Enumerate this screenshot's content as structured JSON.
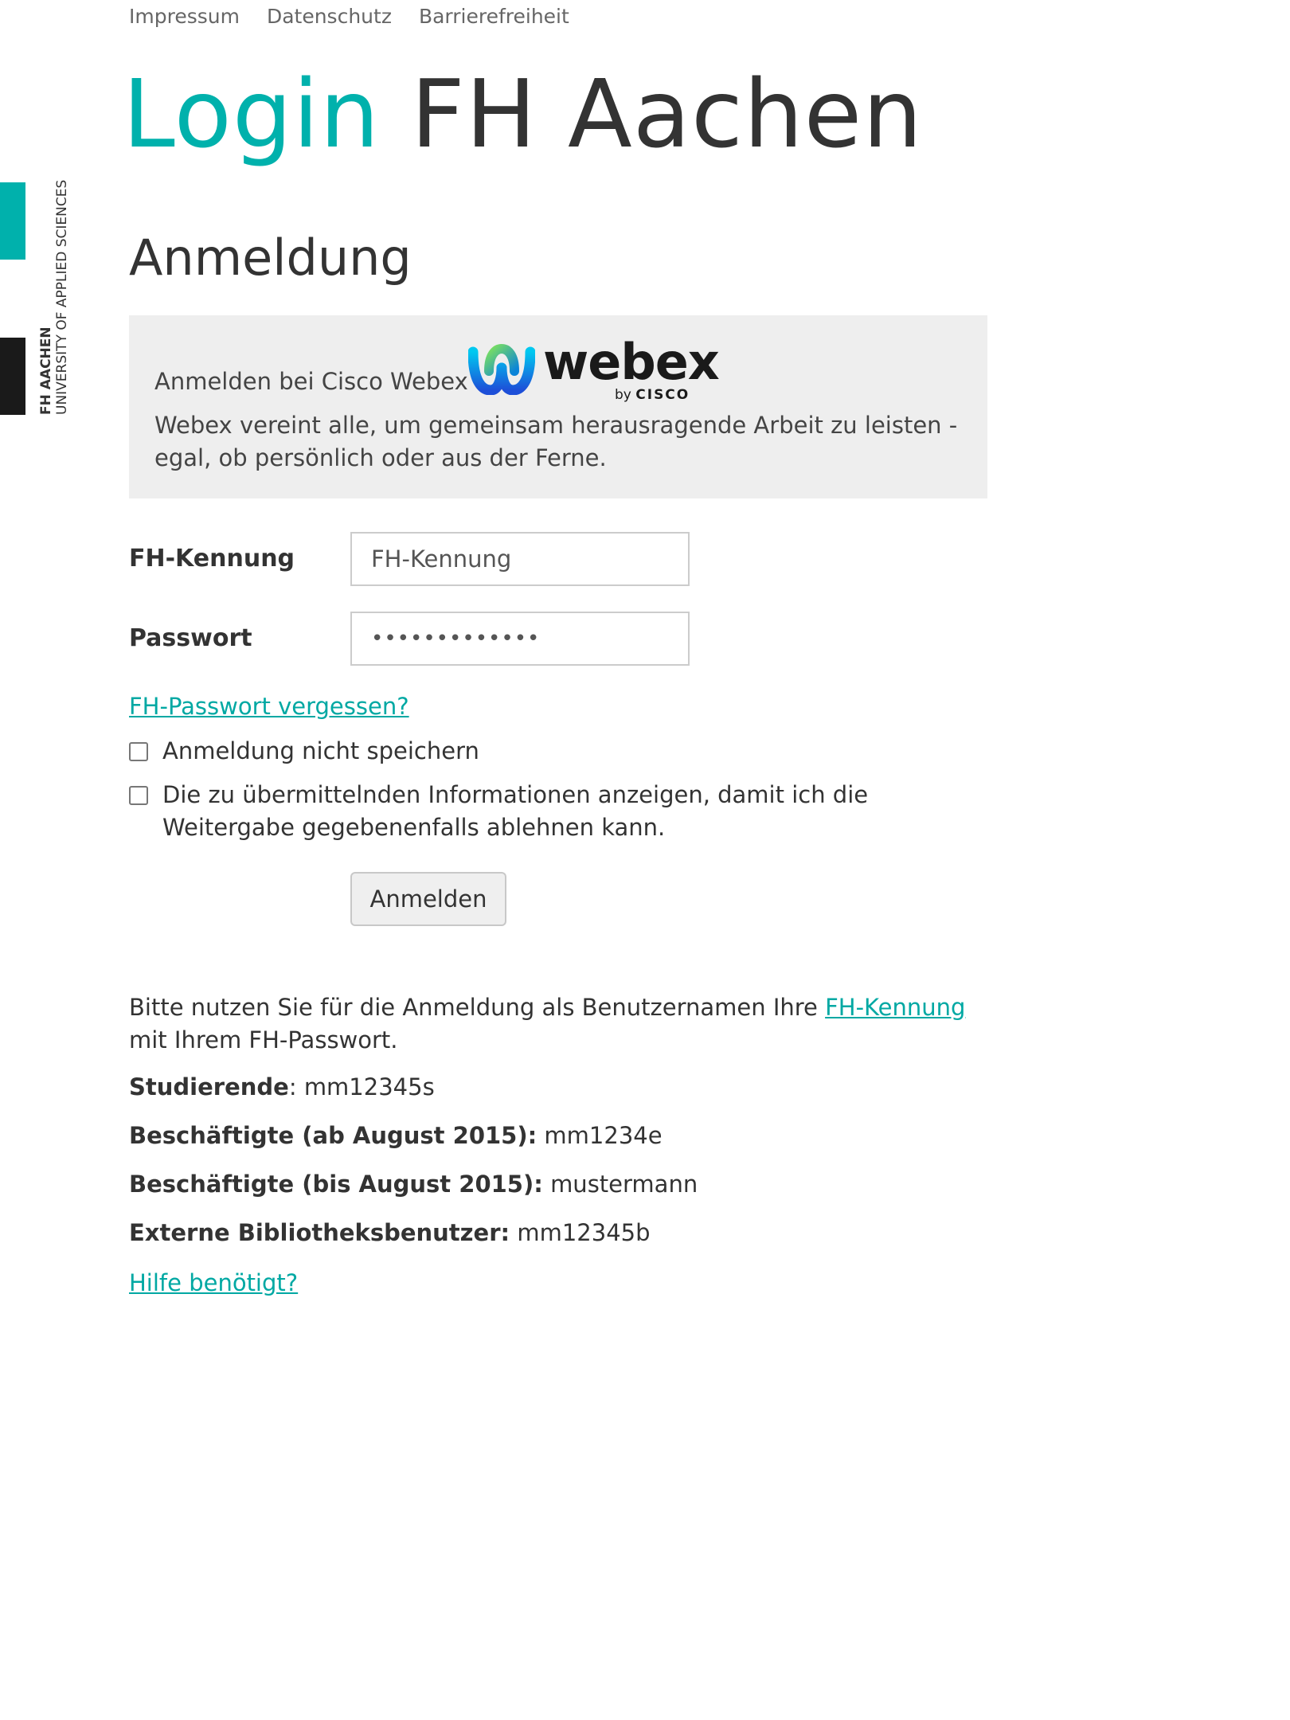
{
  "topnav": {
    "items": [
      "Impressum",
      "Datenschutz",
      "Barrierefreiheit"
    ]
  },
  "hero": {
    "accent": "Login",
    "rest": "FH Aachen"
  },
  "brand": {
    "line1": "FH AACHEN",
    "line2": "UNIVERSITY OF APPLIED SCIENCES"
  },
  "section_title": "Anmeldung",
  "service": {
    "label": "Anmelden bei Cisco Webex",
    "logo_word": "webex",
    "logo_by": "by",
    "logo_cisco": "CISCO",
    "description": "Webex vereint alle, um gemeinsam herausragende Arbeit zu leisten - egal, ob persönlich oder aus der Ferne."
  },
  "form": {
    "username_label": "FH-Kennung",
    "username_placeholder": "FH-Kennung",
    "username_value": "",
    "password_label": "Passwort",
    "password_value": "•••••••••••••",
    "forgot_link": "FH-Passwort vergessen?",
    "checkbox_dont_save": "Anmeldung nicht speichern",
    "checkbox_show_info": "Die zu übermittelnden Informationen anzeigen, damit ich die Weitergabe gegebenenfalls ablehnen kann.",
    "submit_label": "Anmelden"
  },
  "help": {
    "intro_before": "Bitte nutzen Sie für die Anmeldung als Benutzernamen Ihre",
    "intro_link": "FH-Kennung",
    "intro_after": "mit Ihrem FH-Passwort.",
    "examples": [
      {
        "label": "Studierende",
        "sep": ":",
        "value": "mm12345s"
      },
      {
        "label": "Beschäftigte (ab August 2015):",
        "sep": "",
        "value": "mm1234e"
      },
      {
        "label": "Beschäftigte (bis August 2015):",
        "sep": "",
        "value": "mustermann"
      },
      {
        "label": "Externe Bibliotheksbenutzer:",
        "sep": "",
        "value": "mm12345b"
      }
    ],
    "help_link": "Hilfe benötigt?"
  },
  "colors": {
    "accent": "#00b1ac",
    "text": "#333333",
    "info_bg": "#eeeeee"
  }
}
